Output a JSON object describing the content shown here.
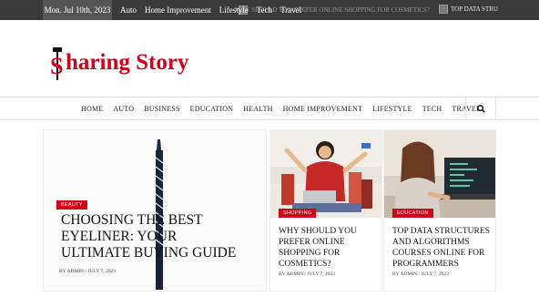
{
  "topbar": {
    "date": "Mon. Jul 10th, 2023",
    "nav": [
      "Auto",
      "Home Improvement",
      "Lifestyle",
      "Tech",
      "Travel"
    ],
    "ticker": [
      "WHY SHOULD YOU PREFER ONLINE SHOPPING FOR COSMETICS?",
      "TOP DATA STRU"
    ]
  },
  "logo": {
    "letter": "S",
    "text": "haring Story"
  },
  "mainnav": {
    "items": [
      "HOME",
      "AUTO",
      "BUSINESS",
      "EDUCATION",
      "HEALTH",
      "HOME IMPROVEMENT",
      "LIFESTYLE",
      "TECH",
      "TRAVEL"
    ],
    "search_icon": "search-icon"
  },
  "featured": {
    "category": "BEAUTY",
    "title": "CHOOSING THE BEST EYELINER: YOUR ULTIMATE BUYING GUIDE",
    "meta": "BY ADMIN  /  JULY 7, 2023"
  },
  "cards": [
    {
      "category": "SHOPPING",
      "title": "WHY SHOULD YOU PREFER ONLINE SHOPPING FOR COSMETICS?",
      "meta": "BY ADMIN  /  JULY 7, 2023"
    },
    {
      "category": "EDUCATION",
      "title": "TOP DATA STRUCTURES AND ALGORITHMS COURSES ONLINE FOR PROGRAMMERS",
      "meta": "BY ADMIN  /  JULY 7, 2023"
    }
  ],
  "colors": {
    "accent": "#d0021b",
    "topbar": "#3a3a3a"
  }
}
